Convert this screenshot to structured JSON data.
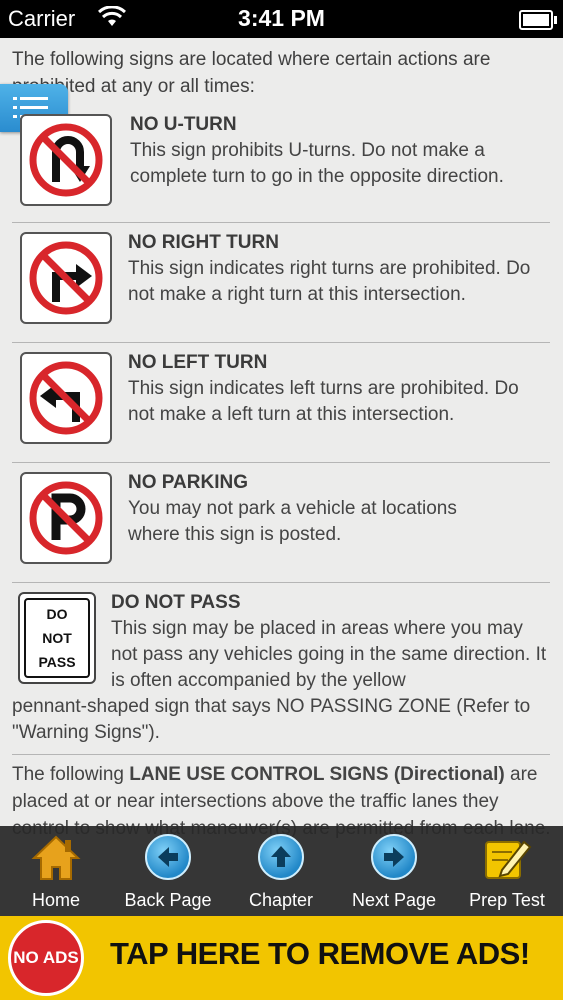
{
  "status": {
    "carrier": "Carrier",
    "time": "3:41 PM"
  },
  "intro": "The following signs are located where certain actions are prohibited at any or all times:",
  "signs": [
    {
      "title": "NO U-TURN",
      "desc": "This sign prohibits U-turns. Do not make a complete turn to go in the opposite direction."
    },
    {
      "title": "NO RIGHT TURN",
      "desc": "This sign indicates right turns are prohibited. Do not make a right turn at this intersection."
    },
    {
      "title": "NO LEFT TURN",
      "desc": "This sign indicates left turns are prohibited. Do not make a left turn at this intersection."
    },
    {
      "title": "NO PARKING",
      "desc": "You may not park a vehicle at locations where this sign is posted."
    },
    {
      "title": "DO NOT PASS",
      "desc1": "This sign may be placed in areas where you may not pass any vehicles going in the same direction. It is often accompanied by the yellow",
      "desc2": "pennant-shaped sign that says NO PASSING ZONE (Refer to \"Warning Signs\")."
    }
  ],
  "dnp_sign": {
    "l1": "DO",
    "l2": "NOT",
    "l3": "PASS"
  },
  "lane": {
    "pre": "The following ",
    "bold1": "LANE USE CONTROL SIGNS",
    "bold2": "(Directional)",
    "post": " are placed at or near intersections above the traffic lanes they control to show what maneuver(s) are permitted from each lane."
  },
  "toolbar": {
    "home": "Home",
    "back": "Back Page",
    "chapter": "Chapter",
    "next": "Next Page",
    "prep": "Prep Test"
  },
  "ad": {
    "badge": "NO ADS",
    "text": "TAP HERE TO REMOVE ADS!"
  },
  "colors": {
    "accent": "#2a8ccf",
    "prohibition_red": "#d8262b",
    "ad_yellow": "#f2c500",
    "toolbar": "#282828"
  }
}
